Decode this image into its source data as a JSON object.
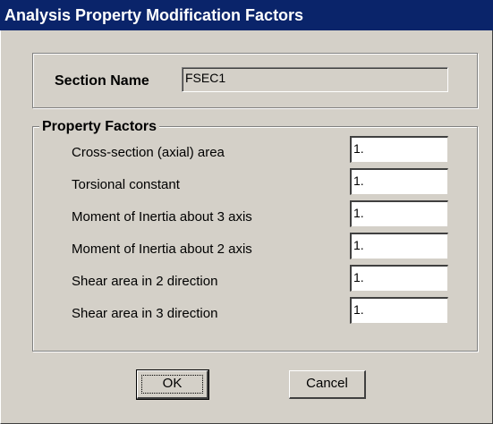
{
  "window": {
    "title": "Analysis Property Modification Factors"
  },
  "section": {
    "label": "Section Name",
    "value": "FSEC1"
  },
  "property_factors": {
    "title": "Property Factors",
    "rows": [
      {
        "label": "Cross-section (axial) area",
        "value": "1."
      },
      {
        "label": "Torsional constant",
        "value": "1."
      },
      {
        "label": "Moment of Inertia about 3 axis",
        "value": "1."
      },
      {
        "label": "Moment of Inertia about 2 axis",
        "value": "1."
      },
      {
        "label": "Shear area in 2 direction",
        "value": "1."
      },
      {
        "label": "Shear area in 3 direction",
        "value": "1."
      }
    ]
  },
  "buttons": {
    "ok": "OK",
    "cancel": "Cancel"
  },
  "colors": {
    "titlebar": "#0a246a",
    "dialog_background": "#d4d0c8",
    "input_background": "#ffffff"
  }
}
